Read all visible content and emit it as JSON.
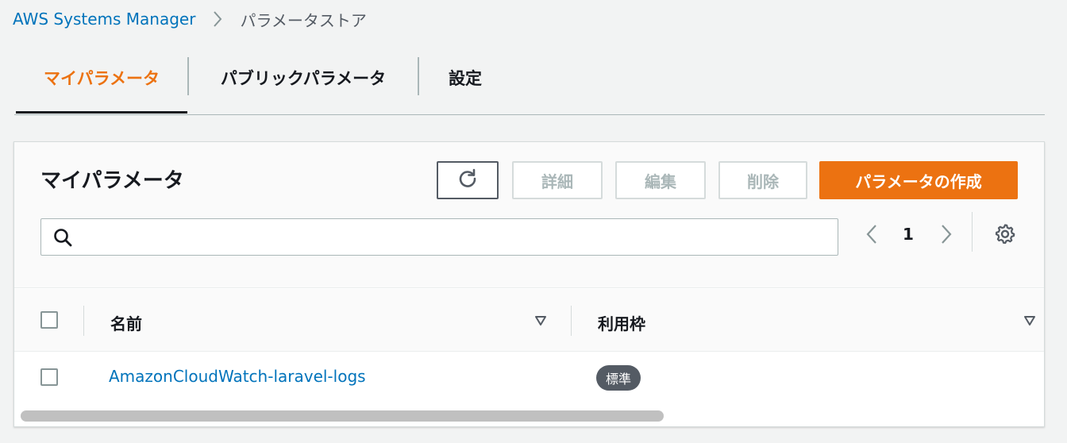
{
  "breadcrumb": {
    "root": "AWS Systems Manager",
    "current": "パラメータストア"
  },
  "tabs": [
    {
      "label": "マイパラメータ",
      "active": true
    },
    {
      "label": "パブリックパラメータ",
      "active": false
    },
    {
      "label": "設定",
      "active": false
    }
  ],
  "panel": {
    "title": "マイパラメータ",
    "buttons": {
      "refresh_icon": "refresh-icon",
      "details": "詳細",
      "edit": "編集",
      "delete": "削除",
      "create": "パラメータの作成"
    },
    "search": {
      "value": "",
      "placeholder": "",
      "icon": "search-icon"
    },
    "pagination": {
      "current_page": "1"
    }
  },
  "table": {
    "columns": [
      "名前",
      "利用枠"
    ],
    "rows": [
      {
        "name": "AmazonCloudWatch-laravel-logs",
        "tier": "標準"
      }
    ]
  },
  "colors": {
    "accent": "#ec7211",
    "link": "#0073bb",
    "text": "#16191f",
    "badge": "#545b64"
  }
}
